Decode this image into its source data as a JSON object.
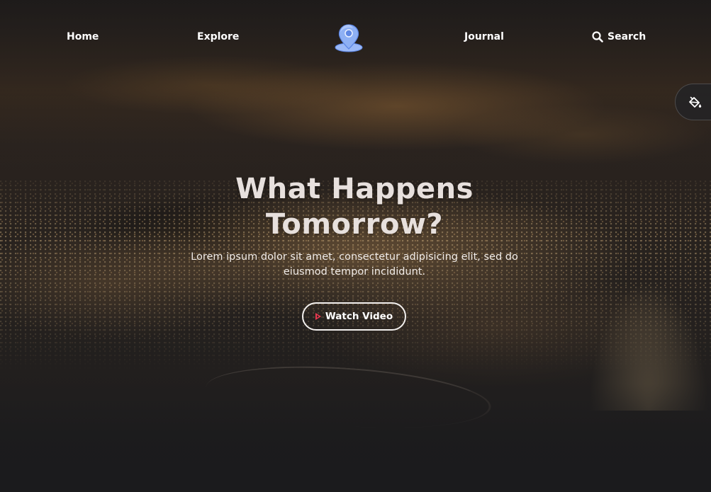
{
  "nav": {
    "items": [
      {
        "label": "Home"
      },
      {
        "label": "Explore"
      },
      {
        "label": "Journal"
      },
      {
        "label": "Search",
        "icon": "search-icon"
      }
    ],
    "logo_icon": "map-pin-icon"
  },
  "side_tool": {
    "icon": "paint-bucket-icon"
  },
  "hero": {
    "title_line1": "What Happens",
    "title_line2": "Tomorrow?",
    "subtitle_line1": "Lorem ipsum dolor sit amet, consectetur adipisicing elit, sed do",
    "subtitle_line2": "eiusmod tempor incididunt.",
    "cta_label": "Watch Video",
    "cta_icon": "play-icon"
  },
  "colors": {
    "accent": "#e8384f",
    "logo_blue": "#6e9cf0",
    "background": "#1b1b1d",
    "text": "#ffffff"
  }
}
